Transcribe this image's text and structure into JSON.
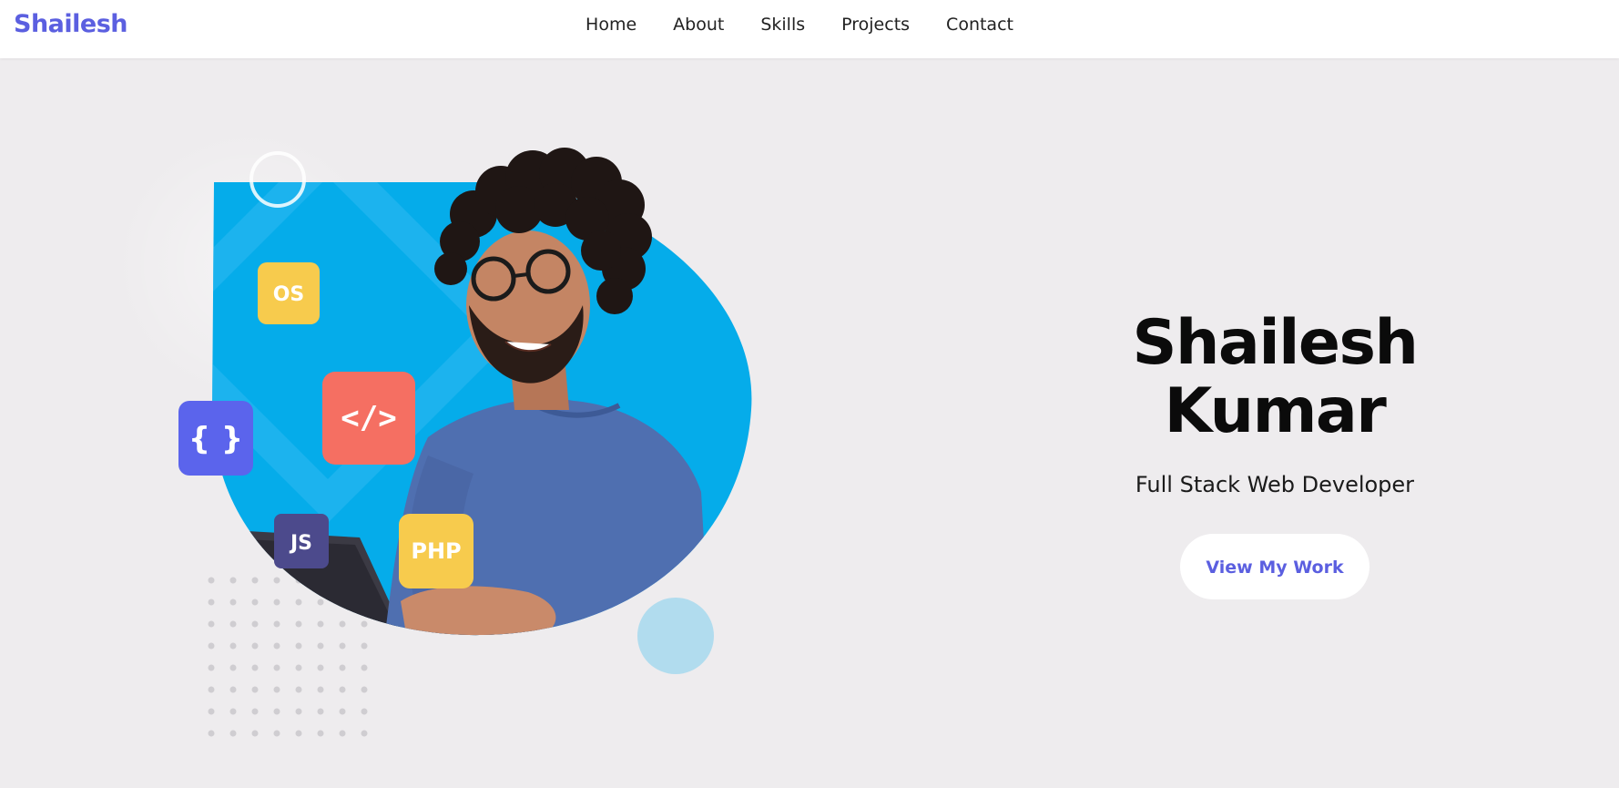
{
  "brand": {
    "name": "Shailesh",
    "color": "#5b5fe0"
  },
  "nav": {
    "items": [
      {
        "label": "Home"
      },
      {
        "label": "About"
      },
      {
        "label": "Skills"
      },
      {
        "label": "Projects"
      },
      {
        "label": "Contact"
      }
    ]
  },
  "hero": {
    "name": "Shailesh Kumar",
    "role": "Full Stack Web Developer",
    "cta_label": "View My Work",
    "illustration": {
      "badges": [
        {
          "icon": "os-badge-icon",
          "text": "OS",
          "color": "#f7cb4d"
        },
        {
          "icon": "code-badge-icon",
          "text": "</>",
          "color": "#f56f62"
        },
        {
          "icon": "braces-badge-icon",
          "text": "{ }",
          "color": "#5b64ec"
        },
        {
          "icon": "js-badge-icon",
          "text": "JS",
          "color": "#4c4a8c"
        },
        {
          "icon": "php-badge-icon",
          "text": "PHP",
          "color": "#f7cb4d"
        }
      ],
      "backdrop_color": "#05acea"
    }
  },
  "colors": {
    "page_background": "#eeecee",
    "accent": "#5b5fe0",
    "shirt": "#4f6fb0"
  }
}
